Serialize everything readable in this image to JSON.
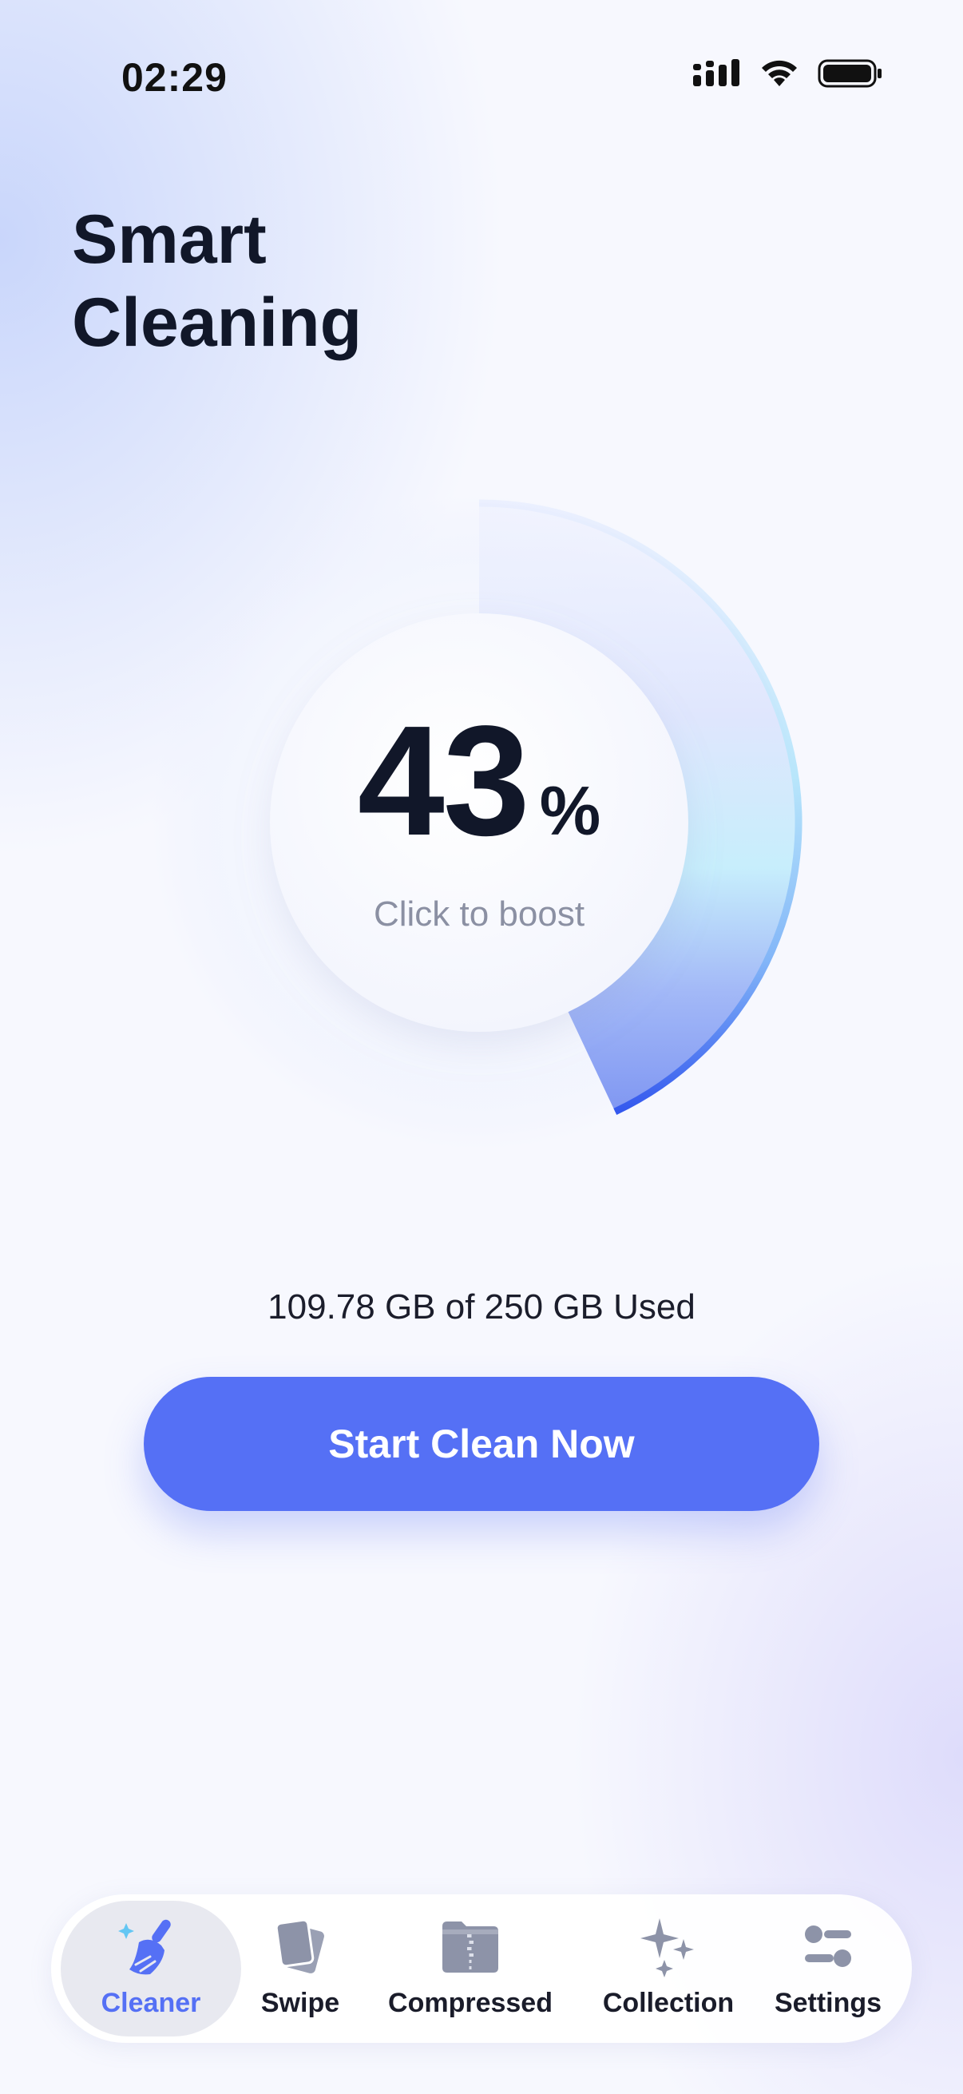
{
  "status_bar": {
    "time": "02:29"
  },
  "header": {
    "title_line1": "Smart",
    "title_line2": "Cleaning"
  },
  "gauge": {
    "percent": 43,
    "value": "43",
    "unit": "%",
    "subtitle": "Click to boost"
  },
  "storage": {
    "text": "109.78 GB of 250 GB Used"
  },
  "primary_button": {
    "label": "Start Clean Now"
  },
  "tabs": [
    {
      "label": "Cleaner",
      "icon": "broom-icon",
      "active": true
    },
    {
      "label": "Swipe",
      "icon": "cards-icon",
      "active": false
    },
    {
      "label": "Compressed",
      "icon": "zip-folder-icon",
      "active": false
    },
    {
      "label": "Collection",
      "icon": "sparkles-icon",
      "active": false
    },
    {
      "label": "Settings",
      "icon": "sliders-icon",
      "active": false
    }
  ],
  "colors": {
    "accent": "#5570f5",
    "title": "#111729",
    "muted": "#8b90a3",
    "arc_light": "#bfeafc"
  }
}
